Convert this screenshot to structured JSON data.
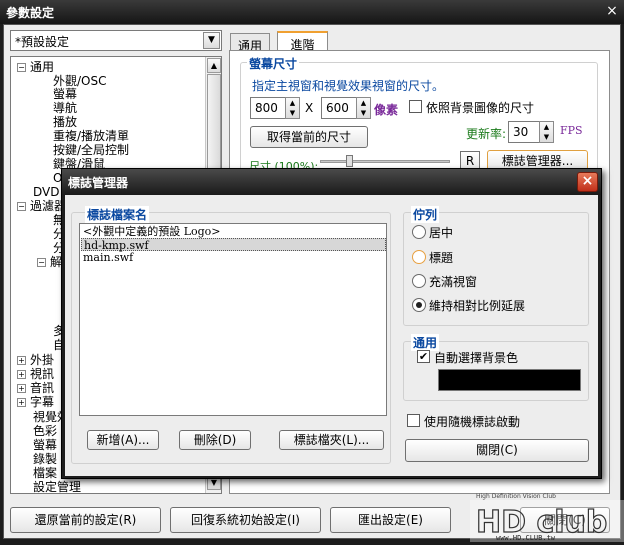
{
  "window": {
    "title": "參數設定",
    "close_glyph": "×"
  },
  "preset": {
    "value": "*預設設定"
  },
  "tree": {
    "items": [
      {
        "label": "通用",
        "toggle": "−"
      },
      {
        "label": "外觀/OSC"
      },
      {
        "label": "螢幕"
      },
      {
        "label": "導航"
      },
      {
        "label": "播放"
      },
      {
        "label": "重複/播放清單"
      },
      {
        "label": "按鍵/全局控制"
      },
      {
        "label": "鍵盤/滑鼠"
      },
      {
        "label": "O"
      },
      {
        "label": "DVD"
      },
      {
        "label": "過濾器",
        "toggle": "−"
      },
      {
        "label": "無"
      },
      {
        "label": "分"
      },
      {
        "label": "分"
      },
      {
        "label": "解",
        "toggle": "−"
      },
      {
        "label": "多"
      },
      {
        "label": "自"
      },
      {
        "label": "外掛",
        "toggle": "+"
      },
      {
        "label": "視訊",
        "toggle": "+"
      },
      {
        "label": "音訊",
        "toggle": "+"
      },
      {
        "label": "字幕",
        "toggle": "+"
      },
      {
        "label": "視覺效"
      },
      {
        "label": "色彩"
      },
      {
        "label": "螢幕"
      },
      {
        "label": "錄製"
      },
      {
        "label": "檔案"
      },
      {
        "label": "設定管理"
      }
    ]
  },
  "tabs": [
    {
      "label": "通用",
      "active": false
    },
    {
      "label": "進階",
      "active": true
    }
  ],
  "screen_size": {
    "group_title": "螢幕尺寸",
    "description": "指定主視窗和視覺效果視窗的尺寸。",
    "width": "800",
    "x_label": "X",
    "height": "600",
    "unit": "像素",
    "follow_bg_label": "依照背景圖像的尺寸",
    "get_current_button": "取得當前的尺寸",
    "refresh_label": "更新率:",
    "refresh_value": "30",
    "fps_label": "FPS",
    "size_label": "尺寸 (100%):",
    "r_button": "R",
    "logo_manager_button": "標誌管理器..."
  },
  "bottom_buttons": {
    "restore": "還原當前的設定(R)",
    "reset": "回復系統初始設定(I)",
    "export": "匯出設定(E)",
    "close": "關閉(C)"
  },
  "logo_dialog": {
    "title": "標誌管理器",
    "close_glyph": "×",
    "list_header": "標誌檔案名",
    "files": [
      {
        "name": "<外觀中定義的預設 Logo>",
        "selected": false
      },
      {
        "name": "hd-kmp.swf",
        "selected": true
      },
      {
        "name": "main.swf",
        "selected": false
      }
    ],
    "add_button": "新增(A)...",
    "delete_button": "刪除(D)",
    "folder_button": "標誌檔夾(L)...",
    "arrange_title": "佇列",
    "arrange_options": [
      {
        "label": "居中",
        "selected": false,
        "hover": false
      },
      {
        "label": "標題",
        "selected": false,
        "hover": true
      },
      {
        "label": "充滿視窗",
        "selected": false,
        "hover": false
      },
      {
        "label": "維持相對比例延展",
        "selected": true,
        "hover": false
      }
    ],
    "general_title": "通用",
    "auto_bg_label": "自動選擇背景色",
    "auto_bg_checked": true,
    "bg_color": "#000000",
    "random_logo_label": "使用隨機標誌啟動",
    "random_logo_checked": false,
    "close_button": "關閉(C)"
  },
  "watermark": {
    "tagline": "High Definition Vision Club",
    "brand": "HD club",
    "url": "www.HD.CLUB.tw"
  },
  "colors": {
    "accent_blue": "#0a48a0",
    "fps_purple": "#7a2a9a",
    "refresh_green": "#1a7a1a",
    "tab_highlight": "#f0a030",
    "dialog_close_red": "#c0301a"
  }
}
